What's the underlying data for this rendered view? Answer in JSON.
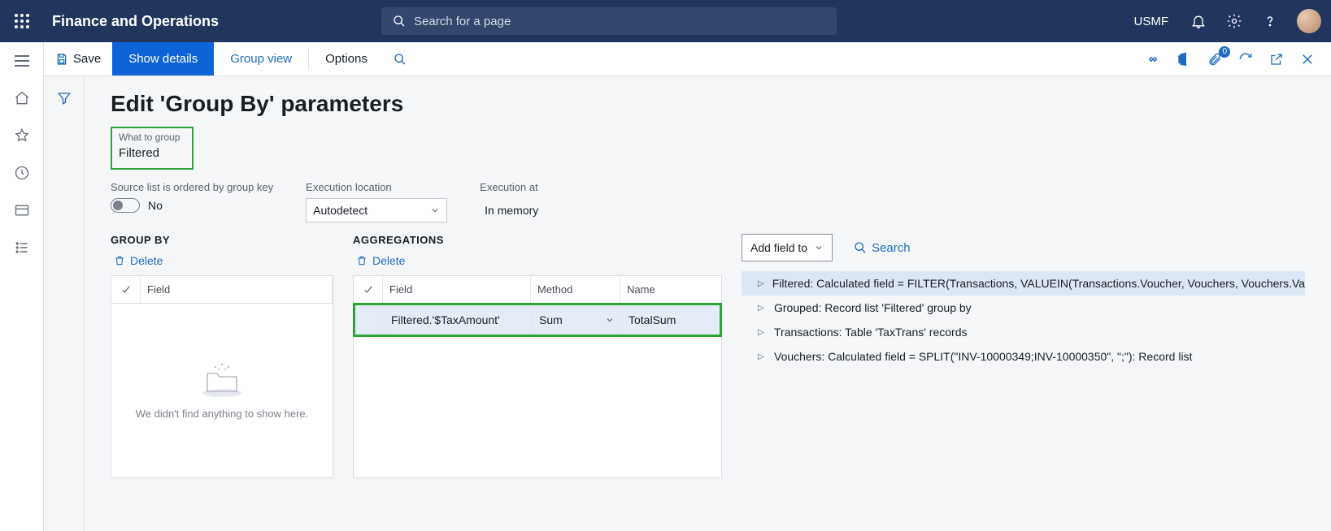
{
  "topbar": {
    "app_title": "Finance and Operations",
    "search_placeholder": "Search for a page",
    "company": "USMF"
  },
  "actionbar": {
    "save": "Save",
    "show_details": "Show details",
    "group_view": "Group view",
    "options": "Options",
    "badge_count": "0"
  },
  "page": {
    "title": "Edit 'Group By' parameters"
  },
  "fields": {
    "what_to_group_label": "What to group",
    "what_to_group_value": "Filtered",
    "ordered_label": "Source list is ordered by group key",
    "ordered_value": "No",
    "exec_location_label": "Execution location",
    "exec_location_value": "Autodetect",
    "exec_at_label": "Execution at",
    "exec_at_value": "In memory"
  },
  "groupby": {
    "heading": "GROUP BY",
    "delete": "Delete",
    "col_field": "Field",
    "empty_msg": "We didn't find anything to show here."
  },
  "aggregations": {
    "heading": "AGGREGATIONS",
    "delete": "Delete",
    "col_field": "Field",
    "col_method": "Method",
    "col_name": "Name",
    "rows": [
      {
        "field": "Filtered.'$TaxAmount'",
        "method": "Sum",
        "name": "TotalSum"
      }
    ]
  },
  "right": {
    "add_btn": "Add field to",
    "search": "Search",
    "tree": [
      "Filtered: Calculated field = FILTER(Transactions, VALUEIN(Transactions.Voucher, Vouchers, Vouchers.Value))",
      "Grouped: Record list 'Filtered' group by",
      "Transactions: Table 'TaxTrans' records",
      "Vouchers: Calculated field = SPLIT(\"INV-10000349;INV-10000350\", \";\"): Record list"
    ]
  }
}
